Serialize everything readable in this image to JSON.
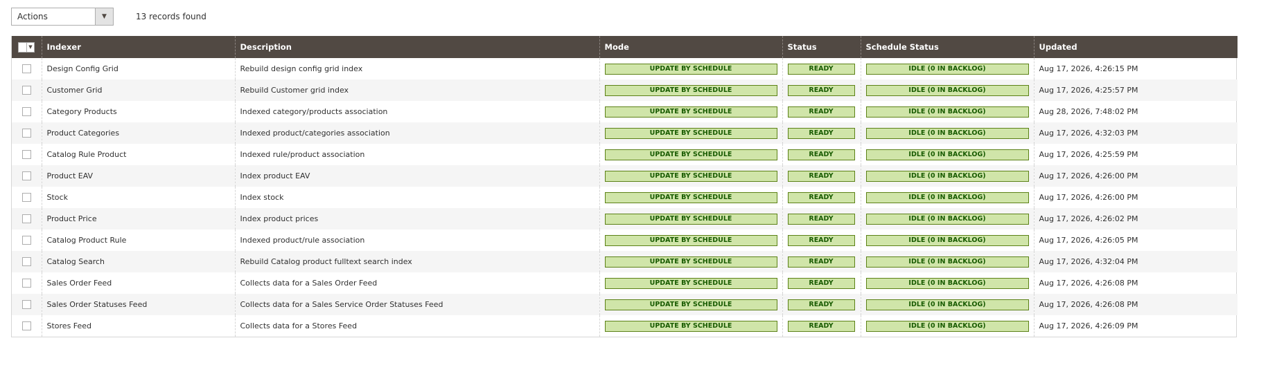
{
  "toolbar": {
    "actions_label": "Actions",
    "records_found": "13 records found"
  },
  "columns": {
    "indexer": "Indexer",
    "description": "Description",
    "mode": "Mode",
    "status": "Status",
    "schedule_status": "Schedule Status",
    "updated": "Updated"
  },
  "rows": [
    {
      "indexer": "Design Config Grid",
      "description": "Rebuild design config grid index",
      "mode": "UPDATE BY SCHEDULE",
      "status": "READY",
      "schedule_status": "IDLE (0 IN BACKLOG)",
      "updated": "Aug 17, 2026, 4:26:15 PM"
    },
    {
      "indexer": "Customer Grid",
      "description": "Rebuild Customer grid index",
      "mode": "UPDATE BY SCHEDULE",
      "status": "READY",
      "schedule_status": "IDLE (0 IN BACKLOG)",
      "updated": "Aug 17, 2026, 4:25:57 PM"
    },
    {
      "indexer": "Category Products",
      "description": "Indexed category/products association",
      "mode": "UPDATE BY SCHEDULE",
      "status": "READY",
      "schedule_status": "IDLE (0 IN BACKLOG)",
      "updated": "Aug 28, 2026, 7:48:02 PM"
    },
    {
      "indexer": "Product Categories",
      "description": "Indexed product/categories association",
      "mode": "UPDATE BY SCHEDULE",
      "status": "READY",
      "schedule_status": "IDLE (0 IN BACKLOG)",
      "updated": "Aug 17, 2026, 4:32:03 PM"
    },
    {
      "indexer": "Catalog Rule Product",
      "description": "Indexed rule/product association",
      "mode": "UPDATE BY SCHEDULE",
      "status": "READY",
      "schedule_status": "IDLE (0 IN BACKLOG)",
      "updated": "Aug 17, 2026, 4:25:59 PM"
    },
    {
      "indexer": "Product EAV",
      "description": "Index product EAV",
      "mode": "UPDATE BY SCHEDULE",
      "status": "READY",
      "schedule_status": "IDLE (0 IN BACKLOG)",
      "updated": "Aug 17, 2026, 4:26:00 PM"
    },
    {
      "indexer": "Stock",
      "description": "Index stock",
      "mode": "UPDATE BY SCHEDULE",
      "status": "READY",
      "schedule_status": "IDLE (0 IN BACKLOG)",
      "updated": "Aug 17, 2026, 4:26:00 PM"
    },
    {
      "indexer": "Product Price",
      "description": "Index product prices",
      "mode": "UPDATE BY SCHEDULE",
      "status": "READY",
      "schedule_status": "IDLE (0 IN BACKLOG)",
      "updated": "Aug 17, 2026, 4:26:02 PM"
    },
    {
      "indexer": "Catalog Product Rule",
      "description": "Indexed product/rule association",
      "mode": "UPDATE BY SCHEDULE",
      "status": "READY",
      "schedule_status": "IDLE (0 IN BACKLOG)",
      "updated": "Aug 17, 2026, 4:26:05 PM"
    },
    {
      "indexer": "Catalog Search",
      "description": "Rebuild Catalog product fulltext search index",
      "mode": "UPDATE BY SCHEDULE",
      "status": "READY",
      "schedule_status": "IDLE (0 IN BACKLOG)",
      "updated": "Aug 17, 2026, 4:32:04 PM"
    },
    {
      "indexer": "Sales Order Feed",
      "description": "Collects data for a Sales Order Feed",
      "mode": "UPDATE BY SCHEDULE",
      "status": "READY",
      "schedule_status": "IDLE (0 IN BACKLOG)",
      "updated": "Aug 17, 2026, 4:26:08 PM"
    },
    {
      "indexer": "Sales Order Statuses Feed",
      "description": "Collects data for a Sales Service Order Statuses Feed",
      "mode": "UPDATE BY SCHEDULE",
      "status": "READY",
      "schedule_status": "IDLE (0 IN BACKLOG)",
      "updated": "Aug 17, 2026, 4:26:08 PM"
    },
    {
      "indexer": "Stores Feed",
      "description": "Collects data for a Stores Feed",
      "mode": "UPDATE BY SCHEDULE",
      "status": "READY",
      "schedule_status": "IDLE (0 IN BACKLOG)",
      "updated": "Aug 17, 2026, 4:26:09 PM"
    }
  ],
  "icons": {
    "select_caret": "▼"
  },
  "colors": {
    "header_bg": "#514943",
    "pill_bg": "#d0e5a9",
    "pill_border": "#5b8116",
    "pill_text": "#185b00"
  }
}
